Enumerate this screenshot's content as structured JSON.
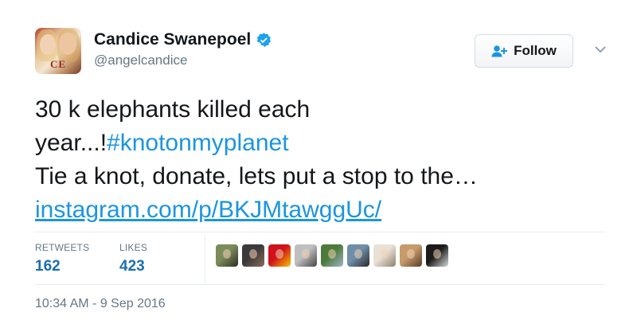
{
  "user": {
    "name": "Candice Swanepoel",
    "handle": "@angelcandice",
    "avatar_text": "CE",
    "verified": true
  },
  "follow_button": {
    "label": "Follow"
  },
  "tweet": {
    "line1": "30 k elephants killed each",
    "line2_prefix": "year...!",
    "hashtag": "#knotonmyplanet",
    "line3": "Tie a knot, donate, lets put a stop to the…",
    "link": "instagram.com/p/BKJMtawggUc/"
  },
  "stats": {
    "retweets_label": "RETWEETS",
    "retweets_count": "162",
    "likes_label": "LIKES",
    "likes_count": "423"
  },
  "likers": [
    {
      "name": "liker-1",
      "colors": [
        "#7b8c5a",
        "#2d2b25"
      ]
    },
    {
      "name": "liker-2",
      "colors": [
        "#3a3a3a",
        "#8a6b55"
      ]
    },
    {
      "name": "liker-3",
      "colors": [
        "#d1111b",
        "#f4c400"
      ]
    },
    {
      "name": "liker-4",
      "colors": [
        "#bfbfbf",
        "#444444"
      ]
    },
    {
      "name": "liker-5",
      "colors": [
        "#4c7a3a",
        "#9fb4c8"
      ]
    },
    {
      "name": "liker-6",
      "colors": [
        "#6f8fa8",
        "#2a2a2a"
      ]
    },
    {
      "name": "liker-7",
      "colors": [
        "#e9e1d6",
        "#8f7f6c"
      ]
    },
    {
      "name": "liker-8",
      "colors": [
        "#c79a6b",
        "#5a3d2a"
      ]
    },
    {
      "name": "liker-9",
      "colors": [
        "#1b1b1b",
        "#d8d8d8"
      ]
    }
  ],
  "timestamp": "10:34 AM - 9 Sep 2016",
  "colors": {
    "accent": "#1b95e0",
    "muted": "#657786",
    "verified": "#1da1f2"
  }
}
